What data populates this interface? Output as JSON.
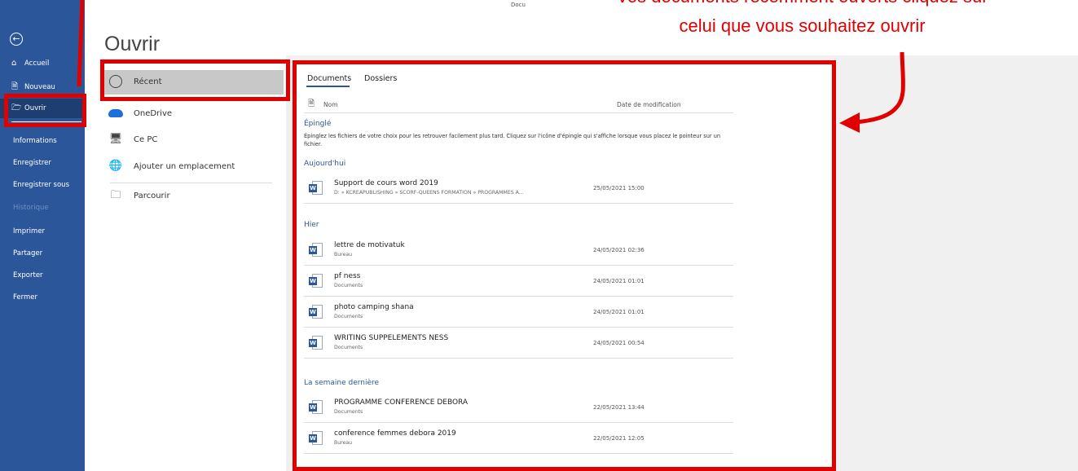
{
  "window": {
    "doc_label": "Docu"
  },
  "nav": {
    "back_icon": "back-arrow-icon",
    "items": [
      {
        "label": "Accueil",
        "icon": "home-icon"
      },
      {
        "label": "Nouveau",
        "icon": "new-document-icon"
      },
      {
        "label": "Ouvrir",
        "icon": "open-folder-icon"
      },
      {
        "label": "Informations"
      },
      {
        "label": "Enregistrer"
      },
      {
        "label": "Enregistrer sous"
      },
      {
        "label": "Historique"
      },
      {
        "label": "Imprimer"
      },
      {
        "label": "Partager"
      },
      {
        "label": "Exporter"
      },
      {
        "label": "Fermer"
      }
    ]
  },
  "page": {
    "title": "Ouvrir"
  },
  "locations": [
    {
      "label": "Récent",
      "icon": "clock-icon"
    },
    {
      "label": "OneDrive",
      "icon": "cloud-icon"
    },
    {
      "label": "Ce PC",
      "icon": "computer-icon"
    },
    {
      "label": "Ajouter un emplacement",
      "icon": "globe-add-icon"
    },
    {
      "label": "Parcourir",
      "icon": "folder-icon"
    }
  ],
  "files_panel": {
    "tabs": [
      "Documents",
      "Dossiers"
    ],
    "columns": {
      "name": "Nom",
      "date": "Date de modification"
    },
    "pinned": {
      "title": "Épinglé",
      "text": "Épinglez les fichiers de votre choix pour les retrouver facilement plus tard. Cliquez sur l'icône d'épingle qui s'affiche lorsque vous placez le pointeur sur un fichier."
    },
    "sections": [
      {
        "title": "Aujourd'hui",
        "files": [
          {
            "name": "Support de cours word 2019",
            "path": "D: » KCREAPUBLISHING » SCORF-QUEENS FORMATION » PROGRAMMES A...",
            "date": "25/05/2021 15:00"
          }
        ]
      },
      {
        "title": "Hier",
        "files": [
          {
            "name": "lettre de motivatuk",
            "path": "Bureau",
            "date": "24/05/2021 02:36"
          },
          {
            "name": "pf ness",
            "path": "Documents",
            "date": "24/05/2021 01:01"
          },
          {
            "name": "photo camping shana",
            "path": "Documents",
            "date": "24/05/2021 01:01"
          },
          {
            "name": "WRITING SUPPELEMENTS NESS",
            "path": "Documents",
            "date": "24/05/2021 00:54"
          }
        ]
      },
      {
        "title": "La semaine dernière",
        "files": [
          {
            "name": "PROGRAMME CONFERENCE DEBORA",
            "path": "Documents",
            "date": "22/05/2021 13:44"
          },
          {
            "name": "conference femmes debora 2019",
            "path": "Bureau",
            "date": "22/05/2021 12:05"
          }
        ]
      }
    ]
  },
  "callout": {
    "line1": "Vos documents récemment ouverts cliquez sur",
    "line2": "celui que vous souhaitez ouvrir",
    "color": "#e00000"
  },
  "colors": {
    "nav_bg": "#2b579a",
    "accent": "#2b579a",
    "highlight": "#e00000"
  }
}
